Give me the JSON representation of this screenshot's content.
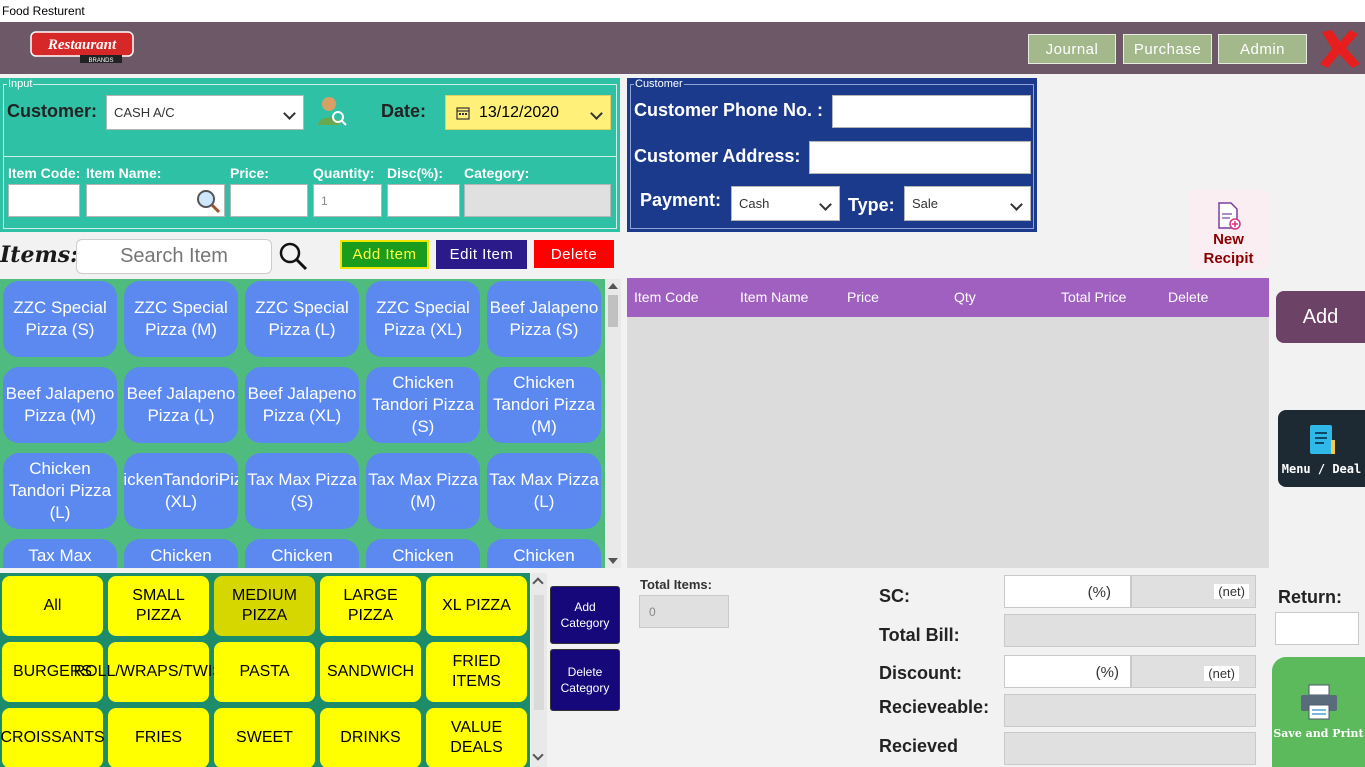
{
  "window": {
    "title": "Food Resturent"
  },
  "logo": {
    "text": "Restaurant",
    "subtext": "BRANDS",
    "color": "#d62828"
  },
  "topnav": {
    "journal": "Journal",
    "purchase": "Purchase",
    "admin": "Admin"
  },
  "input_panel": {
    "legend": "Input",
    "customer_label": "Customer:",
    "customer_value": "CASH A/C",
    "date_label": "Date:",
    "date_value": "13/12/2020",
    "item_code_label": "Item Code:",
    "item_name_label": "Item Name:",
    "price_label": "Price:",
    "quantity_label": "Quantity:",
    "quantity_value": "1",
    "disc_label": "Disc(%):",
    "category_label": "Category:"
  },
  "customer_panel": {
    "legend": "Customer",
    "phone_label": "Customer Phone No. :",
    "address_label": "Customer Address:",
    "payment_label": "Payment:",
    "payment_value": "Cash",
    "type_label": "Type:",
    "type_value": "Sale"
  },
  "items_bar": {
    "label": "Items:",
    "search_placeholder": "Search Item",
    "add_item": "Add Item",
    "edit_item": "Edit Item",
    "delete": "Delete"
  },
  "new_receipt": {
    "line1": "New",
    "line2": "Recipit"
  },
  "menu_items": [
    "ZZC Special Pizza (S)",
    "ZZC Special Pizza (M)",
    "ZZC Special Pizza (L)",
    "ZZC Special Pizza (XL)",
    "Beef Jalapeno Pizza (S)",
    "Beef Jalapeno Pizza (M)",
    "Beef Jalapeno Pizza (L)",
    "Beef Jalapeno Pizza (XL)",
    "Chicken Tandori Pizza (S)",
    "Chicken Tandori Pizza (M)",
    "Chicken Tandori Pizza (L)",
    "ChickenTandoriPizza (XL)",
    "Tax Max Pizza (S)",
    "Tax Max Pizza (M)",
    "Tax Max Pizza (L)",
    "Tax Max",
    "Chicken",
    "Chicken",
    "Chicken",
    "Chicken"
  ],
  "categories": [
    "All",
    "SMALL PIZZA",
    "MEDIUM PIZZA",
    "LARGE PIZZA",
    "XL PIZZA",
    "BURGERS",
    "ROLL/WRAPS/TWISTE",
    "PASTA",
    "SANDWICH",
    "FRIED ITEMS",
    "CROISSANTS",
    "FRIES",
    "SWEET",
    "DRINKS",
    "VALUE DEALS"
  ],
  "selected_category": "MEDIUM PIZZA",
  "category_buttons": {
    "add": "Add Category",
    "delete": "Delete Category"
  },
  "table": {
    "columns": [
      "Item Code",
      "Item Name",
      "Price",
      "Qty",
      "Total Price",
      "Delete"
    ]
  },
  "right_buttons": {
    "add": "Add",
    "menu_deal": "Menu / Deal",
    "save_print": "Save and Print"
  },
  "totals": {
    "total_items_label": "Total Items:",
    "total_items_value": "0",
    "sc_label": "SC:",
    "percent": "(%)",
    "net": "(net)",
    "total_bill_label": "Total Bill:",
    "discount_label": "Discount:",
    "receivable_label": "Recieveable:",
    "received_label": "Recieved",
    "return_label": "Return:"
  },
  "colors": {
    "topbar": "#6d5868",
    "input_panel": "#2fc1a6",
    "customer_panel": "#1b3a8c",
    "item_button": "#5b89f0",
    "category_button": "#ffff00",
    "table_header": "#a060c0",
    "add_item": "#1c9c1c",
    "edit_item": "#2a1a8a",
    "delete": "#ff0000"
  }
}
